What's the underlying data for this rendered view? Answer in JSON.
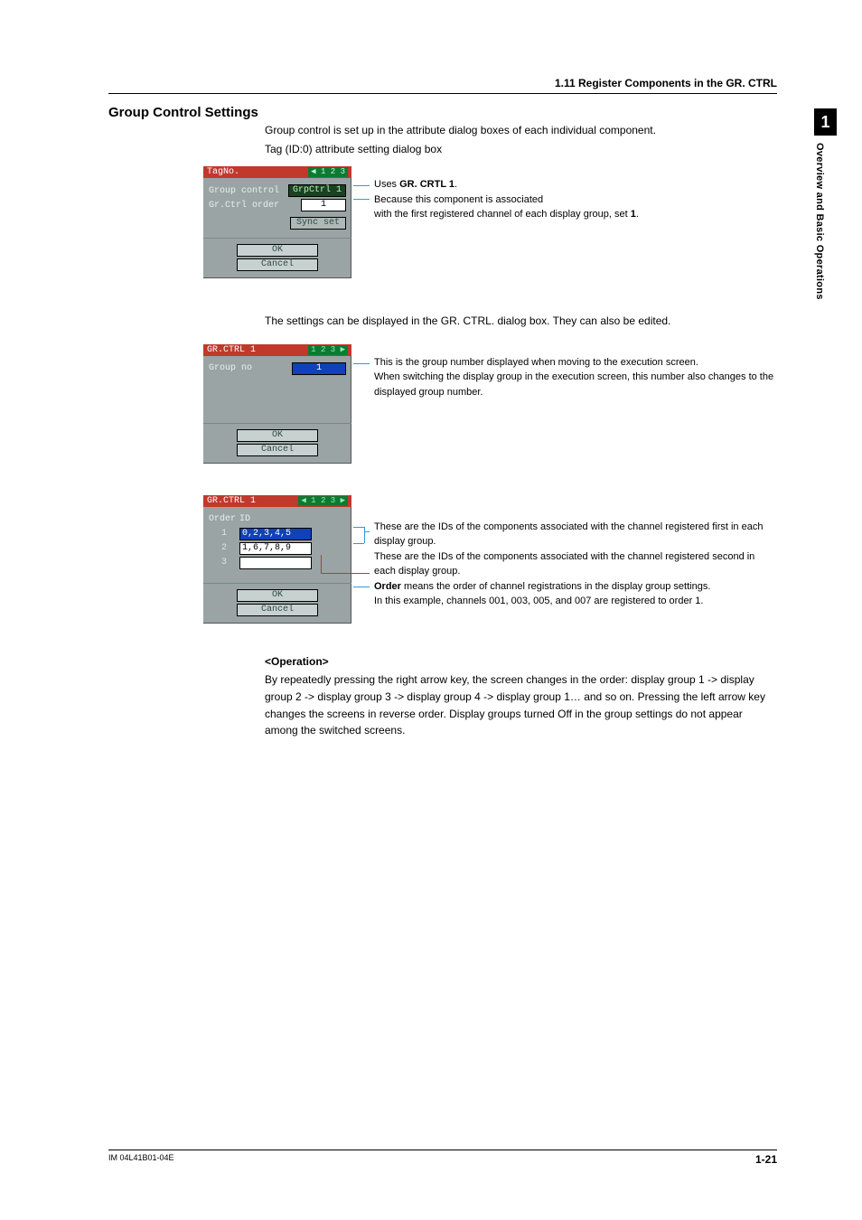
{
  "header": {
    "section": "1.11  Register Components in the GR. CTRL"
  },
  "sidebar": {
    "chapter_num": "1",
    "chapter_title": "Overview and Basic Operations"
  },
  "h2": "Group Control Settings",
  "intro": {
    "p1": "Group control is set up in the attribute dialog boxes of each individual component.",
    "p2": "Tag (ID:0) attribute setting dialog box"
  },
  "dialog1": {
    "title": "TagNo.",
    "page_indicator": "◀ 1 2 3",
    "rows": {
      "r1_label": "Group control",
      "r1_val": "GrpCtrl 1",
      "r2_label": "Gr.Ctrl order",
      "r2_val": "1",
      "r3_btn": "Sync set"
    },
    "ok": "OK",
    "cancel": "Cancel"
  },
  "annot1": {
    "a1_pre": "Uses ",
    "a1_bold": "GR. CRTL 1",
    "a1_post": ".",
    "a2": "Because this component is associated",
    "a3_pre": "with the first registered channel of each display group, set ",
    "a3_bold": "1",
    "a3_post": "."
  },
  "mid_para": "The settings can be displayed in the GR. CTRL. dialog box. They can also be edited.",
  "dialog2": {
    "title": "GR.CTRL 1",
    "page_indicator": "1 2 3 ▶",
    "rows": {
      "r1_label": "Group no",
      "r1_val": "1"
    },
    "ok": "OK",
    "cancel": "Cancel"
  },
  "annot2": {
    "l1": "This is the group number displayed when moving to the execution screen.",
    "l2": "When switching the display group in the execution screen, this number also changes to the displayed group number."
  },
  "dialog3": {
    "title": "GR.CTRL 1",
    "page_indicator": "◀ 1 2 3 ▶",
    "header_order": "Order",
    "header_id": "ID",
    "rows": [
      {
        "order": "1",
        "id": "0,2,3,4,5"
      },
      {
        "order": "2",
        "id": "1,6,7,8,9"
      },
      {
        "order": "3",
        "id": ""
      }
    ],
    "ok": "OK",
    "cancel": "Cancel"
  },
  "annot3": {
    "l1": "These are the IDs of the components associated with the channel registered first in each display group.",
    "l2": "These are the IDs of the components associated with the channel registered second in each display group.",
    "l3_bold": "Order",
    "l3": " means the order of channel registrations in the display group settings.",
    "l4": "In this example, channels 001, 003, 005, and 007 are registered to order 1."
  },
  "op_heading": "<Operation>",
  "op_body": "By repeatedly pressing the right arrow key, the screen changes in the order: display group 1 -> display group 2 -> display group 3 -> display group 4 -> display group 1… and so on. Pressing the left arrow key changes the screens in reverse order. Display groups turned Off in the group settings do not appear among the switched screens.",
  "footer": {
    "left": "IM 04L41B01-04E",
    "right": "1-21"
  }
}
